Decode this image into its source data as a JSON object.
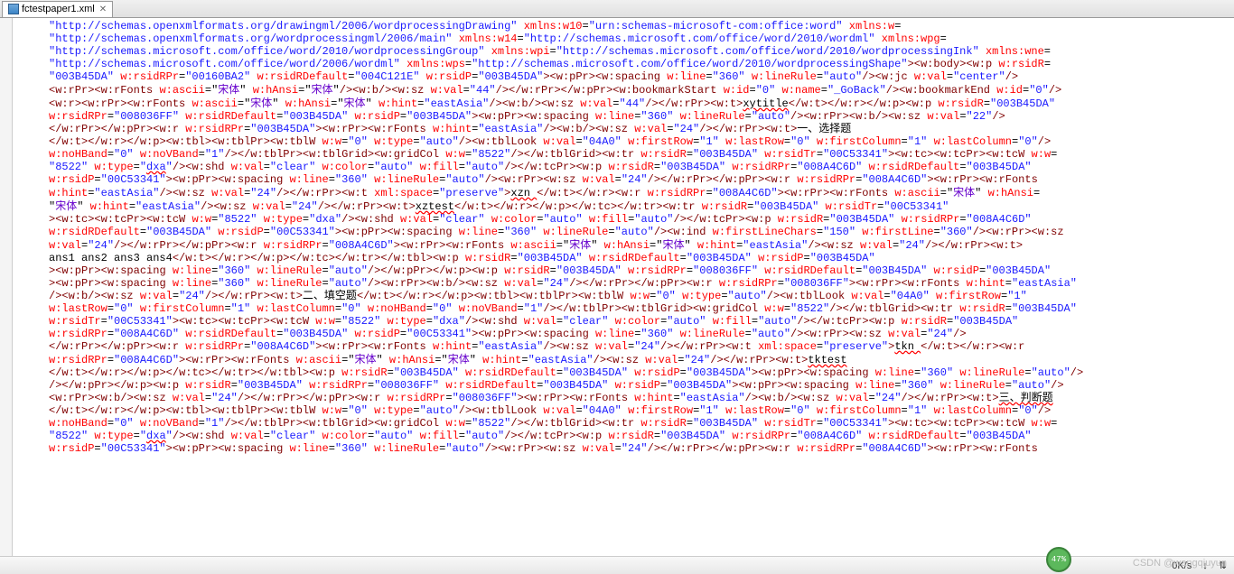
{
  "tab": {
    "filename": "fctestpaper1.xml"
  },
  "status": {
    "speed": "0K/s",
    "conn": "↓",
    "net": "⇅"
  },
  "progress": {
    "pct": "47%"
  },
  "watermark": "CSDN @wangqiuyun",
  "code": {
    "line01": {
      "q1": "http://schemas.openxmlformats.org/drawingml/2006/wordprocessingDrawing",
      "a1": "xmlns:w10",
      "q2": "urn:schemas-microsoft-com:office:word",
      "a2": "xmlns:w"
    },
    "line02": {
      "q1": "http://schemas.openxmlformats.org/wordprocessingml/2006/main",
      "a1": "xmlns:w14",
      "q2": "http://schemas.microsoft.com/office/word/2010/wordml",
      "a2": "xmlns:wpg"
    },
    "line03": {
      "q1": "http://schemas.microsoft.com/office/word/2010/wordprocessingGroup",
      "a1": "xmlns:wpi",
      "q2": "http://schemas.microsoft.com/office/word/2010/wordprocessingInk",
      "a2": "xmlns:wne"
    },
    "line04": {
      "q1": "http://schemas.microsoft.com/office/word/2006/wordml",
      "a1": "xmlns:wps",
      "q2": "http://schemas.microsoft.com/office/word/2010/wordprocessingShape",
      "t1": "w:body",
      "t2": "w:p",
      "a2": "w:rsidR"
    },
    "line05": {
      "q1": "003B45DA",
      "a1": "w:rsidRPr",
      "q2": "00160BA2",
      "a2": "w:rsidRDefault",
      "q3": "004C121E",
      "a3": "w:rsidP",
      "q4": "003B45DA",
      "t1": "w:pPr",
      "t2": "w:spacing",
      "a4": "w:line",
      "q5": "360",
      "a5": "w:lineRule",
      "q6": "auto",
      "t3": "w:jc",
      "a6": "w:val",
      "q7": "center"
    },
    "line06": {
      "t1": "w:rPr",
      "t2": "w:rFonts",
      "a1": "w:ascii",
      "f1": "宋体",
      "a2": "w:hAnsi",
      "f2": "宋体",
      "t3": "w:b",
      "t4": "w:sz",
      "a3": "w:val",
      "q1": "44",
      "t5": "w:rPr",
      "t6": "w:pPr",
      "t7": "w:bookmarkStart",
      "a4": "w:id",
      "q2": "0",
      "a5": "w:name",
      "q3": "_GoBack",
      "t8": "w:bookmarkEnd",
      "a6": "w:id",
      "q4": "0"
    },
    "line07": {
      "t1": "w:r",
      "t2": "w:rPr",
      "t3": "w:rFonts",
      "a1": "w:ascii",
      "f1": "宋体",
      "a2": "w:hAnsi",
      "f2": "宋体",
      "a3": "w:hint",
      "q1": "eastAsia",
      "t4": "w:b",
      "t5": "w:sz",
      "a4": "w:val",
      "q2": "44",
      "t6": "w:rPr",
      "t7": "w:t",
      "tx1": "xytitle",
      "t8": "w:t",
      "t9": "w:r",
      "t10": "w:p",
      "t11": "w:p",
      "a5": "w:rsidR",
      "q3": "003B45DA"
    },
    "line08": {
      "a1": "w:rsidRPr",
      "q1": "008036FF",
      "a2": "w:rsidRDefault",
      "q2": "003B45DA",
      "a3": "w:rsidP",
      "q3": "003B45DA",
      "t1": "w:pPr",
      "t2": "w:spacing",
      "a4": "w:line",
      "q4": "360",
      "a5": "w:lineRule",
      "q5": "auto",
      "t3": "w:rPr",
      "t4": "w:b",
      "t5": "w:sz",
      "a6": "w:val",
      "q6": "22"
    },
    "line09": {
      "t1": "w:rPr",
      "t2": "w:pPr",
      "t3": "w:r",
      "a1": "w:rsidRPr",
      "q1": "003B45DA",
      "t4": "w:rPr",
      "t5": "w:rFonts",
      "a2": "w:hint",
      "q2": "eastAsia",
      "t6": "w:b",
      "t7": "w:sz",
      "a3": "w:val",
      "q3": "24",
      "t8": "w:rPr",
      "t9": "w:t",
      "tx1": "一、选择题"
    },
    "line10": {
      "t1": "w:t",
      "t2": "w:r",
      "t3": "w:p",
      "t4": "w:tbl",
      "t5": "w:tblPr",
      "t6": "w:tblW",
      "a1": "w:w",
      "q1": "0",
      "a2": "w:type",
      "q2": "auto",
      "t7": "w:tblLook",
      "a3": "w:val",
      "q3": "04A0",
      "a4": "w:firstRow",
      "q4": "1",
      "a5": "w:lastRow",
      "q5": "0",
      "a6": "w:firstColumn",
      "q6": "1",
      "a7": "w:lastColumn",
      "q7": "0"
    },
    "line11": {
      "a1": "w:noHBand",
      "q1": "0",
      "a2": "w:noVBand",
      "q2": "1",
      "t1": "w:tblPr",
      "t2": "w:tblGrid",
      "t3": "w:gridCol",
      "a3": "w:w",
      "q3": "8522",
      "t4": "w:tblGrid",
      "t5": "w:tr",
      "a4": "w:rsidR",
      "q4": "003B45DA",
      "a5": "w:rsidTr",
      "q5": "00C53341",
      "t6": "w:tc",
      "t7": "w:tcPr",
      "t8": "w:tcW",
      "a6": "w:w"
    },
    "line12": {
      "q1": "8522",
      "a1": "w:type",
      "q2": "dxa",
      "t1": "w:shd",
      "a2": "w:val",
      "q3": "clear",
      "a3": "w:color",
      "q4": "auto",
      "a4": "w:fill",
      "q5": "auto",
      "t2": "w:tcPr",
      "t3": "w:p",
      "a5": "w:rsidR",
      "q6": "003B45DA",
      "a6": "w:rsidRPr",
      "q7": "008A4C6D",
      "a7": "w:rsidRDefault",
      "q8": "003B45DA"
    },
    "line13": {
      "a1": "w:rsidP",
      "q1": "00C53341",
      "t1": "w:pPr",
      "t2": "w:spacing",
      "a2": "w:line",
      "q2": "360",
      "a3": "w:lineRule",
      "q3": "auto",
      "t3": "w:rPr",
      "t4": "w:sz",
      "a4": "w:val",
      "q4": "24",
      "t5": "w:rPr",
      "t6": "w:pPr",
      "t7": "w:r",
      "a5": "w:rsidRPr",
      "q5": "008A4C6D",
      "t8": "w:rPr",
      "t9": "w:rFonts"
    },
    "line14": {
      "a1": "w:hint",
      "q1": "eastAsia",
      "t1": "w:sz",
      "a2": "w:val",
      "q2": "24",
      "t2": "w:rPr",
      "t3": "w:t",
      "a3": "xml:space",
      "q3": "preserve",
      "tx1": "xzn ",
      "t4": "w:t",
      "t5": "w:r",
      "t6": "w:r",
      "a4": "w:rsidRPr",
      "q4": "008A4C6D",
      "t7": "w:rPr",
      "t8": "w:rFonts",
      "a5": "w:ascii",
      "f1": "宋体",
      "a6": "w:hAnsi"
    },
    "line15": {
      "f1": "宋体",
      "a1": "w:hint",
      "q1": "eastAsia",
      "t1": "w:sz",
      "a2": "w:val",
      "q2": "24",
      "t2": "w:rPr",
      "t3": "w:t",
      "tx1": "xztest",
      "t4": "w:t",
      "t5": "w:r",
      "t6": "w:p",
      "t7": "w:tc",
      "t8": "w:tr",
      "t9": "w:tr",
      "a3": "w:rsidR",
      "q3": "003B45DA",
      "a4": "w:rsidTr",
      "q4": "00C53341"
    },
    "line16": {
      "t1": "w:tc",
      "t2": "w:tcPr",
      "t3": "w:tcW",
      "a1": "w:w",
      "q1": "8522",
      "a2": "w:type",
      "q2": "dxa",
      "t4": "w:shd",
      "a3": "w:val",
      "q3": "clear",
      "a4": "w:color",
      "q4": "auto",
      "a5": "w:fill",
      "q5": "auto",
      "t5": "w:tcPr",
      "t6": "w:p",
      "a6": "w:rsidR",
      "q6": "003B45DA",
      "a7": "w:rsidRPr",
      "q7": "008A4C6D"
    },
    "line17": {
      "a1": "w:rsidRDefault",
      "q1": "003B45DA",
      "a2": "w:rsidP",
      "q2": "00C53341",
      "t1": "w:pPr",
      "t2": "w:spacing",
      "a3": "w:line",
      "q3": "360",
      "a4": "w:lineRule",
      "q4": "auto",
      "t3": "w:ind",
      "a5": "w:firstLineChars",
      "q5": "150",
      "a6": "w:firstLine",
      "q6": "360",
      "t4": "w:rPr",
      "t5": "w:sz"
    },
    "line18": {
      "a1": "w:val",
      "q1": "24",
      "t1": "w:rPr",
      "t2": "w:pPr",
      "t3": "w:r",
      "a2": "w:rsidRPr",
      "q2": "008A4C6D",
      "t4": "w:rPr",
      "t5": "w:rFonts",
      "a3": "w:ascii",
      "f1": "宋体",
      "a4": "w:hAnsi",
      "f2": "宋体",
      "a5": "w:hint",
      "q3": "eastAsia",
      "t6": "w:sz",
      "a6": "w:val",
      "q4": "24",
      "t7": "w:rPr",
      "t8": "w:t"
    },
    "line19": {
      "tx1": "ans1   ans2   ans3   ans4",
      "t1": "w:t",
      "t2": "w:r",
      "t3": "w:p",
      "t4": "w:tc",
      "t5": "w:tr",
      "t6": "w:tbl",
      "t7": "w:p",
      "a1": "w:rsidR",
      "q1": "003B45DA",
      "a2": "w:rsidRDefault",
      "q2": "003B45DA",
      "a3": "w:rsidP",
      "q3": "003B45DA"
    },
    "line20": {
      "t1": "w:pPr",
      "t2": "w:spacing",
      "a1": "w:line",
      "q1": "360",
      "a2": "w:lineRule",
      "q2": "auto",
      "t3": "w:pPr",
      "t4": "w:p",
      "t5": "w:p",
      "a3": "w:rsidR",
      "q3": "003B45DA",
      "a4": "w:rsidRPr",
      "q4": "008036FF",
      "a5": "w:rsidRDefault",
      "q5": "003B45DA",
      "a6": "w:rsidP",
      "q6": "003B45DA"
    },
    "line21": {
      "t1": "w:pPr",
      "t2": "w:spacing",
      "a1": "w:line",
      "q1": "360",
      "a2": "w:lineRule",
      "q2": "auto",
      "t3": "w:rPr",
      "t4": "w:b",
      "t5": "w:sz",
      "a3": "w:val",
      "q3": "24",
      "t6": "w:rPr",
      "t7": "w:pPr",
      "t8": "w:r",
      "a4": "w:rsidRPr",
      "q4": "008036FF",
      "t9": "w:rPr",
      "t10": "w:rFonts",
      "a5": "w:hint",
      "q5": "eastAsia"
    },
    "line22": {
      "t1": "w:b",
      "t2": "w:sz",
      "a1": "w:val",
      "q1": "24",
      "t3": "w:rPr",
      "t4": "w:t",
      "tx1": "二、填空题",
      "t5": "w:t",
      "t6": "w:r",
      "t7": "w:p",
      "t8": "w:tbl",
      "t9": "w:tblPr",
      "t10": "w:tblW",
      "a2": "w:w",
      "q2": "0",
      "a3": "w:type",
      "q3": "auto",
      "t11": "w:tblLook",
      "a4": "w:val",
      "q4": "04A0",
      "a5": "w:firstRow",
      "q5": "1"
    },
    "line23": {
      "a1": "w:lastRow",
      "q1": "0",
      "a2": "w:firstColumn",
      "q2": "1",
      "a3": "w:lastColumn",
      "q3": "0",
      "a4": "w:noHBand",
      "q4": "0",
      "a5": "w:noVBand",
      "q5": "1",
      "t1": "w:tblPr",
      "t2": "w:tblGrid",
      "t3": "w:gridCol",
      "a6": "w:w",
      "q6": "8522",
      "t4": "w:tblGrid",
      "t5": "w:tr",
      "a7": "w:rsidR",
      "q7": "003B45DA"
    },
    "line24": {
      "a1": "w:rsidTr",
      "q1": "00C53341",
      "t1": "w:tc",
      "t2": "w:tcPr",
      "t3": "w:tcW",
      "a2": "w:w",
      "q2": "8522",
      "a3": "w:type",
      "q3": "dxa",
      "t4": "w:shd",
      "a4": "w:val",
      "q4": "clear",
      "a5": "w:color",
      "q5": "auto",
      "a6": "w:fill",
      "q6": "auto",
      "t5": "w:tcPr",
      "t6": "w:p",
      "a7": "w:rsidR",
      "q7": "003B45DA"
    },
    "line25": {
      "a1": "w:rsidRPr",
      "q1": "008A4C6D",
      "a2": "w:rsidRDefault",
      "q2": "003B45DA",
      "a3": "w:rsidP",
      "q3": "00C53341",
      "t1": "w:pPr",
      "t2": "w:spacing",
      "a4": "w:line",
      "q4": "360",
      "a5": "w:lineRule",
      "q5": "auto",
      "t3": "w:rPr",
      "t4": "w:sz",
      "a6": "w:val",
      "q6": "24"
    },
    "line26": {
      "t1": "w:rPr",
      "t2": "w:pPr",
      "t3": "w:r",
      "a1": "w:rsidRPr",
      "q1": "008A4C6D",
      "t4": "w:rPr",
      "t5": "w:rFonts",
      "a2": "w:hint",
      "q2": "eastAsia",
      "t6": "w:sz",
      "a3": "w:val",
      "q3": "24",
      "t7": "w:rPr",
      "t8": "w:t",
      "a4": "xml:space",
      "q4": "preserve",
      "tx1": "tkn ",
      "t9": "w:t",
      "t10": "w:r",
      "t11": "w:r"
    },
    "line27": {
      "a1": "w:rsidRPr",
      "q1": "008A4C6D",
      "t1": "w:rPr",
      "t2": "w:rFonts",
      "a2": "w:ascii",
      "f1": "宋体",
      "a3": "w:hAnsi",
      "f2": "宋体",
      "a4": "w:hint",
      "q2": "eastAsia",
      "t3": "w:sz",
      "a5": "w:val",
      "q3": "24",
      "t4": "w:rPr",
      "t5": "w:t",
      "tx1": "tktest"
    },
    "line28": {
      "t1": "w:t",
      "t2": "w:r",
      "t3": "w:p",
      "t4": "w:tc",
      "t5": "w:tr",
      "t6": "w:tbl",
      "t7": "w:p",
      "a1": "w:rsidR",
      "q1": "003B45DA",
      "a2": "w:rsidRDefault",
      "q2": "003B45DA",
      "a3": "w:rsidP",
      "q3": "003B45DA",
      "t8": "w:pPr",
      "t9": "w:spacing",
      "a4": "w:line",
      "q4": "360",
      "a5": "w:lineRule",
      "q5": "auto"
    },
    "line29": {
      "t1": "w:pPr",
      "t2": "w:p",
      "t3": "w:p",
      "a1": "w:rsidR",
      "q1": "003B45DA",
      "a2": "w:rsidRPr",
      "q2": "008036FF",
      "a3": "w:rsidRDefault",
      "q3": "003B45DA",
      "a4": "w:rsidP",
      "q4": "003B45DA",
      "t4": "w:pPr",
      "t5": "w:spacing",
      "a5": "w:line",
      "q5": "360",
      "a6": "w:lineRule",
      "q6": "auto"
    },
    "line30": {
      "t1": "w:rPr",
      "t2": "w:b",
      "t3": "w:sz",
      "a1": "w:val",
      "q1": "24",
      "t4": "w:rPr",
      "t5": "w:pPr",
      "t6": "w:r",
      "a2": "w:rsidRPr",
      "q2": "008036FF",
      "t7": "w:rPr",
      "t8": "w:rFonts",
      "a3": "w:hint",
      "q3": "eastAsia",
      "t9": "w:b",
      "t10": "w:sz",
      "a4": "w:val",
      "q4": "24",
      "t11": "w:rPr",
      "t12": "w:t",
      "tx1": "三、判断题"
    },
    "line31": {
      "t1": "w:t",
      "t2": "w:r",
      "t3": "w:p",
      "t4": "w:tbl",
      "t5": "w:tblPr",
      "t6": "w:tblW",
      "a1": "w:w",
      "q1": "0",
      "a2": "w:type",
      "q2": "auto",
      "t7": "w:tblLook",
      "a3": "w:val",
      "q3": "04A0",
      "a4": "w:firstRow",
      "q4": "1",
      "a5": "w:lastRow",
      "q5": "0",
      "a6": "w:firstColumn",
      "q6": "1",
      "a7": "w:lastColumn",
      "q7": "0"
    },
    "line32": {
      "a1": "w:noHBand",
      "q1": "0",
      "a2": "w:noVBand",
      "q2": "1",
      "t1": "w:tblPr",
      "t2": "w:tblGrid",
      "t3": "w:gridCol",
      "a3": "w:w",
      "q3": "8522",
      "t4": "w:tblGrid",
      "t5": "w:tr",
      "a4": "w:rsidR",
      "q4": "003B45DA",
      "a5": "w:rsidTr",
      "q5": "00C53341",
      "t6": "w:tc",
      "t7": "w:tcPr",
      "t8": "w:tcW",
      "a6": "w:w"
    },
    "line33": {
      "q1": "8522",
      "a1": "w:type",
      "q2": "dxa",
      "t1": "w:shd",
      "a2": "w:val",
      "q3": "clear",
      "a3": "w:color",
      "q4": "auto",
      "a4": "w:fill",
      "q5": "auto",
      "t2": "w:tcPr",
      "t3": "w:p",
      "a5": "w:rsidR",
      "q6": "003B45DA",
      "a6": "w:rsidRPr",
      "q7": "008A4C6D",
      "a7": "w:rsidRDefault",
      "q8": "003B45DA"
    },
    "line34": {
      "a1": "w:rsidP",
      "q1": "00C53341",
      "t1": "w:pPr",
      "t2": "w:spacing",
      "a2": "w:line",
      "q2": "360",
      "a3": "w:lineRule",
      "q3": "auto",
      "t3": "w:rPr",
      "t4": "w:sz",
      "a4": "w:val",
      "q4": "24",
      "t5": "w:rPr",
      "t6": "w:pPr",
      "t7": "w:r",
      "a5": "w:rsidRPr",
      "q5": "008A4C6D",
      "t8": "w:rPr",
      "t9": "w:rFonts"
    }
  }
}
